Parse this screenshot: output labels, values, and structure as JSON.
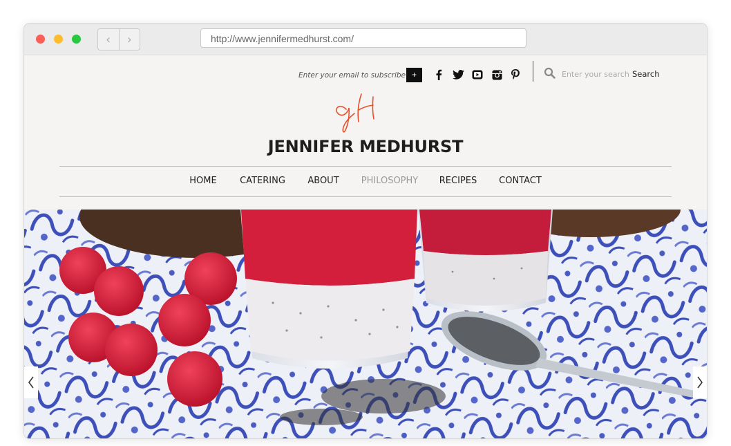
{
  "browser": {
    "url": "http://www.jennifermedhurst.com/",
    "back_glyph": "‹",
    "forward_glyph": "›"
  },
  "header": {
    "subscribe": {
      "placeholder": "Enter your email to subscribe",
      "button_label": "+"
    },
    "social_icons": [
      "facebook-icon",
      "twitter-icon",
      "youtube-icon",
      "instagram-icon",
      "pinterest-icon"
    ],
    "search": {
      "placeholder": "Enter your search",
      "button_label": "Search"
    },
    "logo_text": "JENNIFER MEDHURST",
    "colors": {
      "logo_mark": "#e8502a",
      "background": "#f5f4f2",
      "text": "#1e1e1e"
    }
  },
  "nav": {
    "items": [
      {
        "label": "HOME",
        "active": false
      },
      {
        "label": "CATERING",
        "active": false
      },
      {
        "label": "ABOUT",
        "active": false
      },
      {
        "label": "PHILOSOPHY",
        "active": true
      },
      {
        "label": "RECIPES",
        "active": false
      },
      {
        "label": "CONTACT",
        "active": false
      }
    ]
  },
  "slider": {
    "image_subject": "chia-pudding-raspberry-icon",
    "prev_icon": "chevron-left-icon",
    "next_icon": "chevron-right-icon"
  }
}
